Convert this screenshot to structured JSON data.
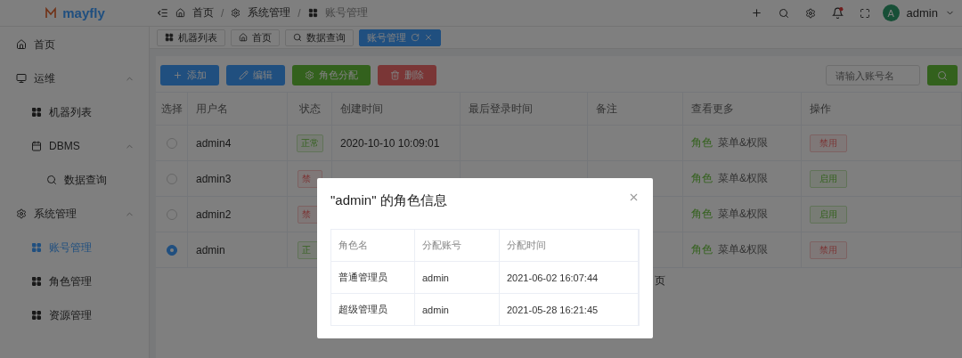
{
  "header": {
    "logo_text": "mayfly",
    "breadcrumb": [
      {
        "label": "首页"
      },
      {
        "separator": "/",
        "label": "系统管理"
      },
      {
        "separator": "/",
        "label": "账号管理"
      }
    ],
    "user": {
      "avatar_letter": "A",
      "name": "admin"
    }
  },
  "sidebar": {
    "items": [
      {
        "label": "首页",
        "selected": false
      },
      {
        "label": "运维",
        "selected": false,
        "expanded": true,
        "children": [
          {
            "label": "机器列表",
            "selected": false
          },
          {
            "label": "DBMS",
            "selected": false,
            "expanded": true,
            "children": [
              {
                "label": "数据查询",
                "selected": false
              }
            ]
          }
        ]
      },
      {
        "label": "系统管理",
        "selected": false,
        "expanded": true,
        "children": [
          {
            "label": "账号管理",
            "selected": true
          },
          {
            "label": "角色管理",
            "selected": false
          },
          {
            "label": "资源管理",
            "selected": false
          }
        ]
      }
    ]
  },
  "tabs": [
    {
      "label": "机器列表",
      "selected": false
    },
    {
      "label": "首页",
      "selected": false
    },
    {
      "label": "数据查询",
      "selected": false
    },
    {
      "label": "账号管理",
      "selected": true
    }
  ],
  "toolbar": {
    "buttons": [
      {
        "label": "添加",
        "kind": "add"
      },
      {
        "label": "编辑",
        "kind": "edit"
      },
      {
        "label": "角色分配",
        "kind": "role"
      },
      {
        "label": "删除",
        "kind": "delete"
      }
    ],
    "search": {
      "placeholder": "请输入账号名"
    }
  },
  "table": {
    "columns": [
      "选择",
      "用户名",
      "状态",
      "创建时间",
      "最后登录时间",
      "备注",
      "查看更多",
      "操作"
    ],
    "rows": [
      {
        "selected": false,
        "username": "admin4",
        "status": {
          "label": "正常",
          "kind": "ok"
        },
        "created": "2020-10-10 10:09:01",
        "more": [
          "角色",
          "菜单&权限"
        ],
        "action": {
          "label": "禁用",
          "kind": "disable"
        }
      },
      {
        "selected": false,
        "username": "admin3",
        "status": {
          "label": "禁",
          "kind": "off"
        },
        "more": [
          "角色",
          "菜单&权限"
        ],
        "action": {
          "label": "启用",
          "kind": "enable"
        }
      },
      {
        "selected": false,
        "username": "admin2",
        "status": {
          "label": "禁",
          "kind": "off"
        },
        "more": [
          "角色",
          "菜单&权限"
        ],
        "action": {
          "label": "启用",
          "kind": "enable"
        }
      },
      {
        "selected": true,
        "username": "admin",
        "status": {
          "label": "正",
          "kind": "ok"
        },
        "more": [
          "角色",
          "菜单&权限"
        ],
        "action": {
          "label": "禁用",
          "kind": "disable"
        }
      }
    ],
    "pager_text": "页"
  },
  "dialog": {
    "title": "\"admin\" 的角色信息",
    "columns": [
      "角色名",
      "分配账号",
      "分配时间"
    ],
    "rows": [
      [
        "普通管理员",
        "admin",
        "2021-06-02 16:07:44"
      ],
      [
        "超级管理员",
        "admin",
        "2021-05-28 16:21:45"
      ]
    ]
  }
}
